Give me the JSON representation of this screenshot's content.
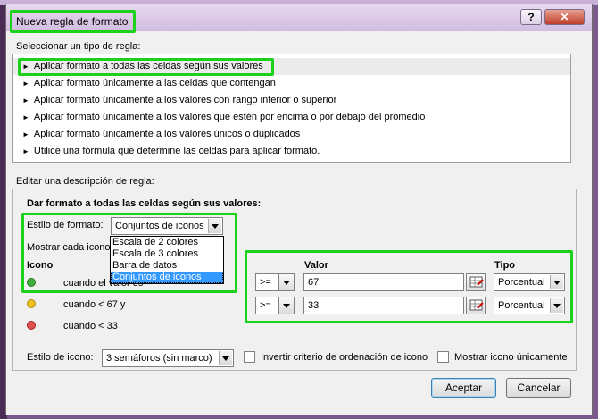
{
  "window": {
    "title": "Nueva regla de formato",
    "help_label": "?",
    "close_label": "✕"
  },
  "rule_type": {
    "label": "Seleccionar un tipo de regla:",
    "items": [
      {
        "label": "Aplicar formato a todas las celdas según sus valores"
      },
      {
        "label": "Aplicar formato únicamente a las celdas que contengan"
      },
      {
        "label": "Aplicar formato únicamente a los valores con rango inferior o superior"
      },
      {
        "label": "Aplicar formato únicamente a los valores que estén por encima o por debajo del promedio"
      },
      {
        "label": "Aplicar formato únicamente a los valores únicos o duplicados"
      },
      {
        "label": "Utilice una fórmula que determine las celdas para aplicar formato."
      }
    ],
    "arrow": "►"
  },
  "description": {
    "label": "Editar una descripción de regla:",
    "heading": "Dar formato a todas las celdas según sus valores:",
    "format_style_label": "Estilo de formato:",
    "format_style_value": "Conjuntos de iconos",
    "show_each_icon_label": "Mostrar cada icono s",
    "dropdown_options": [
      "Escala de 2 colores",
      "Escala de 3 colores",
      "Barra de datos",
      "Conjuntos de iconos"
    ],
    "icon_header": "Icono",
    "value_header": "Valor",
    "type_header": "Tipo",
    "rows": [
      {
        "text": "cuando el valor es",
        "color": "#3fae3f",
        "operator": ">=",
        "value": "67",
        "type": "Porcentual"
      },
      {
        "text": "cuando < 67 y",
        "color": "#f0c020",
        "operator": ">=",
        "value": "33",
        "type": "Porcentual"
      },
      {
        "text": "cuando < 33",
        "color": "#e05050",
        "operator": "",
        "value": "",
        "type": ""
      }
    ],
    "icon_style_label": "Estilo de icono:",
    "icon_style_value": "3 semáforos (sin marco)",
    "reverse_order_label": "Invertir criterio de ordenación de icono",
    "show_icon_only_label": "Mostrar icono únicamente"
  },
  "buttons": {
    "ok": "Aceptar",
    "cancel": "Cancelar"
  }
}
